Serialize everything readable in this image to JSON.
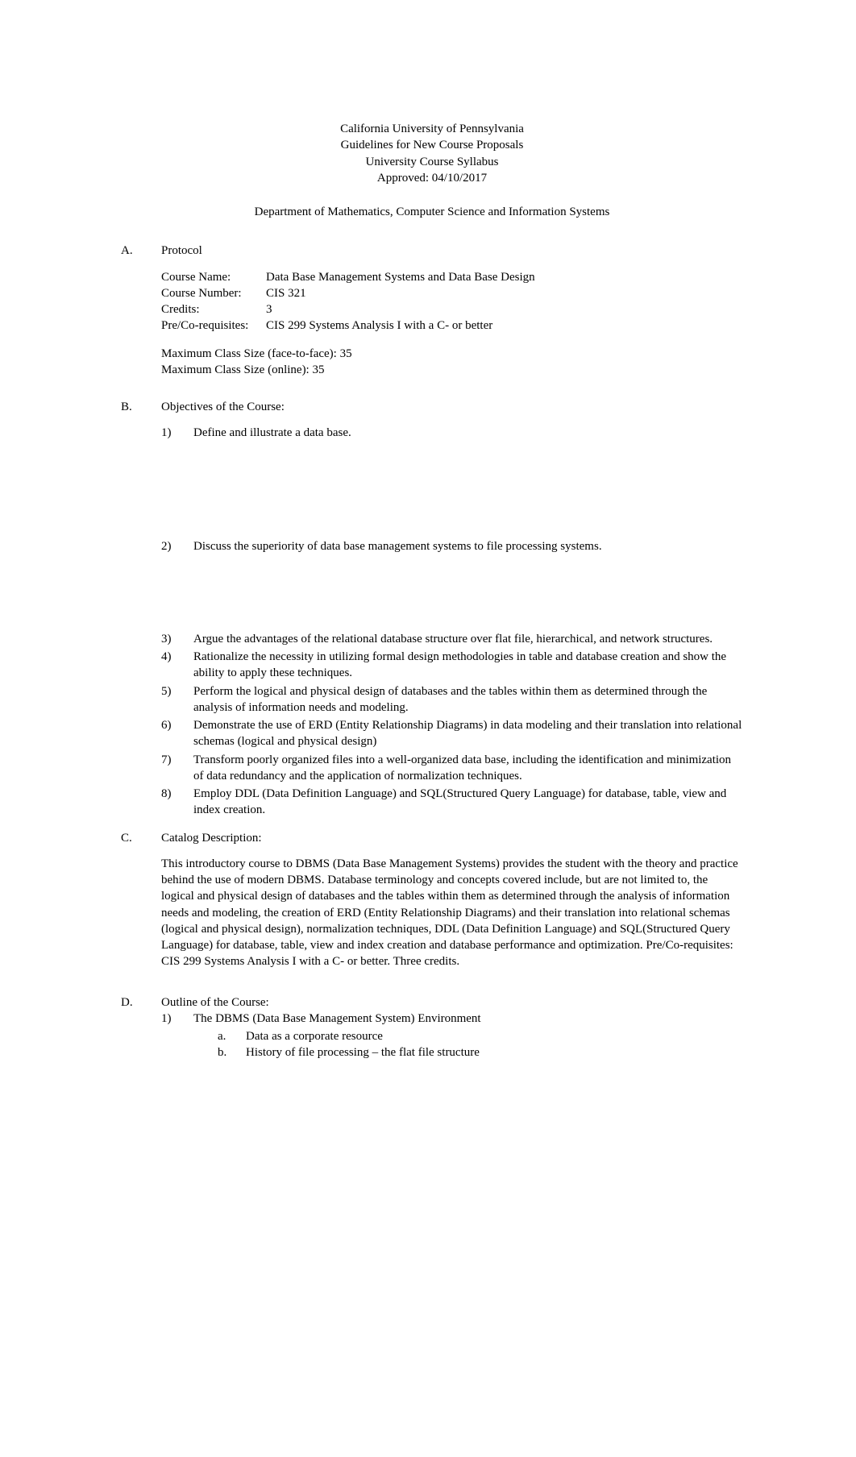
{
  "header": {
    "line1": "California University of Pennsylvania",
    "line2": "Guidelines for New Course Proposals",
    "line3": "University Course Syllabus",
    "line4": "Approved: 04/10/2017"
  },
  "department": "Department of Mathematics, Computer Science and Information Systems",
  "sectionA": {
    "letter": "A.",
    "title": "Protocol",
    "fields": {
      "courseName": {
        "label": "Course Name:",
        "value": "Data Base Management Systems and Data Base Design"
      },
      "courseNumber": {
        "label": "Course Number:",
        "value": "CIS 321"
      },
      "credits": {
        "label": "Credits:",
        "value": "3"
      },
      "prereq": {
        "label": "Pre/Co-requisites:",
        "value": "CIS 299 Systems Analysis I with a C- or better"
      }
    },
    "maxFace": "Maximum Class Size (face-to-face):  35",
    "maxOnline": "Maximum Class Size (online): 35"
  },
  "sectionB": {
    "letter": "B.",
    "title": "Objectives of the Course:",
    "items": [
      {
        "num": "1)",
        "text": "Define and illustrate a data base.",
        "gap": "big"
      },
      {
        "num": "2)",
        "text": "Discuss the superiority of data base management systems to file processing systems.",
        "gap": "med"
      },
      {
        "num": "3)",
        "text": "Argue the advantages of the relational database structure over flat file, hierarchical, and network structures.",
        "gap": "normal"
      },
      {
        "num": "4)",
        "text": "Rationalize the necessity in utilizing formal design methodologies in table and database creation and show the ability to apply these techniques.",
        "gap": "normal"
      },
      {
        "num": "5)",
        "text": "Perform the logical and physical design of databases and the tables within them as determined through the analysis of information needs and modeling.",
        "gap": "normal"
      },
      {
        "num": "6)",
        "text": "Demonstrate the use of ERD (Entity Relationship Diagrams) in data modeling and their translation into relational schemas (logical and physical design)",
        "gap": "normal"
      },
      {
        "num": "7)",
        "text": "Transform poorly organized files into a well-organized data base, including the identification and minimization of data redundancy and the application of normalization techniques.",
        "gap": "normal"
      },
      {
        "num": "8)",
        "text": "Employ DDL (Data Definition Language) and SQL(Structured Query Language) for database, table, view and index creation.",
        "gap": "normal"
      }
    ]
  },
  "sectionC": {
    "letter": "C.",
    "title": "Catalog Description:",
    "description": "This introductory course to DBMS (Data Base Management Systems) provides the student with the theory and practice behind the use of modern DBMS.  Database terminology and concepts covered include, but are not limited to, the logical and physical design of databases and the tables within them as determined through the analysis of information needs and modeling, the creation of ERD (Entity Relationship Diagrams) and their translation into relational schemas (logical and physical design), normalization techniques, DDL (Data Definition Language) and SQL(Structured Query Language) for database, table, view and index creation and database performance and optimization.  Pre/Co-requisites:   CIS 299 Systems Analysis I with a C- or better.  Three credits."
  },
  "sectionD": {
    "letter": "D.",
    "title": "Outline of the Course:",
    "items": [
      {
        "num": "1)",
        "text": "The DBMS (Data Base Management System) Environment",
        "subitems": [
          {
            "letter": "a.",
            "text": "Data as a corporate resource"
          },
          {
            "letter": "b.",
            "text": "History of file processing – the flat file structure"
          }
        ]
      }
    ]
  }
}
